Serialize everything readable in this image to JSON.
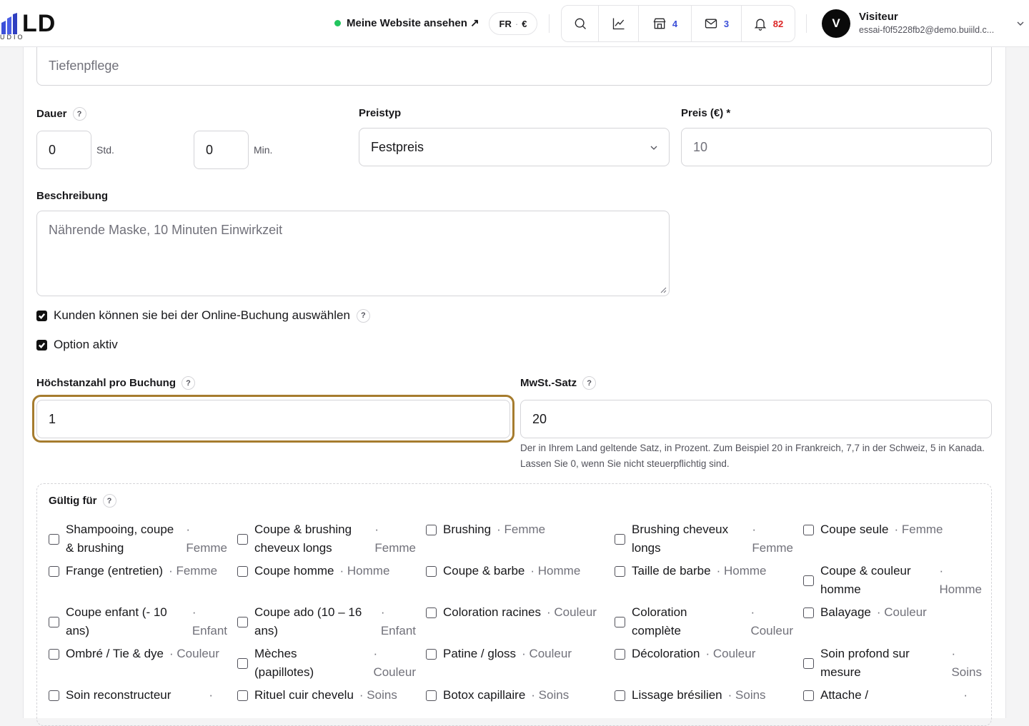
{
  "header": {
    "logo_text": "LD",
    "logo_sub": "UDIO",
    "site_link": "Meine Website ansehen ↗",
    "lang": "FR",
    "currency": "€",
    "shop_count": "4",
    "mail_count": "3",
    "notif_count": "82",
    "avatar_letter": "V",
    "user_name": "Visiteur",
    "user_email": "essai-f0f5228fb2@demo.buiild.c..."
  },
  "form": {
    "name_value": "Tiefenpflege",
    "duration_label": "Dauer",
    "hours_value": "0",
    "hours_unit": "Std.",
    "minutes_value": "0",
    "minutes_unit": "Min.",
    "price_type_label": "Preistyp",
    "price_type_value": "Festpreis",
    "price_label": "Preis (€) *",
    "price_value": "10",
    "description_label": "Beschreibung",
    "description_value": "Nährende Maske, 10 Minuten Einwirkzeit",
    "online_booking_label": "Kunden können sie bei der Online-Buchung auswählen",
    "option_active_label": "Option aktiv",
    "max_per_booking_label": "Höchstanzahl pro Buchung",
    "max_per_booking_value": "1",
    "vat_label": "MwSt.-Satz",
    "vat_value": "20",
    "vat_hint": "Der in Ihrem Land geltende Satz, in Prozent. Zum Beispiel 20 in Frankreich, 7,7 in der Schweiz, 5 in Kanada. Lassen Sie 0, wenn Sie nicht steuerpflichtig sind.",
    "valid_for_label": "Gültig für",
    "help_mark": "?"
  },
  "services": [
    {
      "l1": "Shampooing, coupe",
      "l2": "& brushing",
      "cat": "Femme"
    },
    {
      "l1": "Coupe & brushing",
      "l2": "cheveux longs",
      "cat": "Femme"
    },
    {
      "l1": "Brushing",
      "l2": "",
      "cat": "Femme"
    },
    {
      "l1": "Brushing cheveux",
      "l2": "longs",
      "cat": "Femme"
    },
    {
      "l1": "Coupe seule",
      "l2": "",
      "cat": "Femme"
    },
    {
      "l1": "Frange (entretien)",
      "l2": "",
      "cat": "Femme"
    },
    {
      "l1": "Coupe homme",
      "l2": "",
      "cat": "Homme"
    },
    {
      "l1": "Coupe & barbe",
      "l2": "",
      "cat": "Homme"
    },
    {
      "l1": "Taille de barbe",
      "l2": "",
      "cat": "Homme"
    },
    {
      "l1": "Coupe & couleur",
      "l2": "homme",
      "cat": "Homme"
    },
    {
      "l1": "Coupe enfant (- 10",
      "l2": "ans)",
      "cat": "Enfant"
    },
    {
      "l1": "Coupe ado (10 – 16",
      "l2": "ans)",
      "cat": "Enfant"
    },
    {
      "l1": "Coloration racines",
      "l2": "",
      "cat": "Couleur"
    },
    {
      "l1": "Coloration",
      "l2": "complète",
      "cat": "Couleur"
    },
    {
      "l1": "Balayage",
      "l2": "",
      "cat": "Couleur"
    },
    {
      "l1": "Ombré / Tie & dye",
      "l2": "",
      "cat": "Couleur"
    },
    {
      "l1": "Mèches",
      "l2": "(papillotes)",
      "cat": "Couleur"
    },
    {
      "l1": "Patine / gloss",
      "l2": "",
      "cat": "Couleur"
    },
    {
      "l1": "Décoloration",
      "l2": "",
      "cat": "Couleur"
    },
    {
      "l1": "Soin profond sur",
      "l2": "mesure",
      "cat": "Soins"
    },
    {
      "l1": "Soin reconstructeur",
      "l2": "",
      "cat": ""
    },
    {
      "l1": "Rituel cuir chevelu",
      "l2": "",
      "cat": "Soins"
    },
    {
      "l1": "Botox capillaire",
      "l2": "",
      "cat": "Soins"
    },
    {
      "l1": "Lissage brésilien",
      "l2": "",
      "cat": "Soins"
    },
    {
      "l1": "Attache /",
      "l2": "",
      "cat": ""
    }
  ],
  "colors": {
    "accent_focus": "#a67c2e",
    "status_green": "#22c55e",
    "count_blue": "#3b4fd8",
    "count_red": "#dc2626"
  }
}
